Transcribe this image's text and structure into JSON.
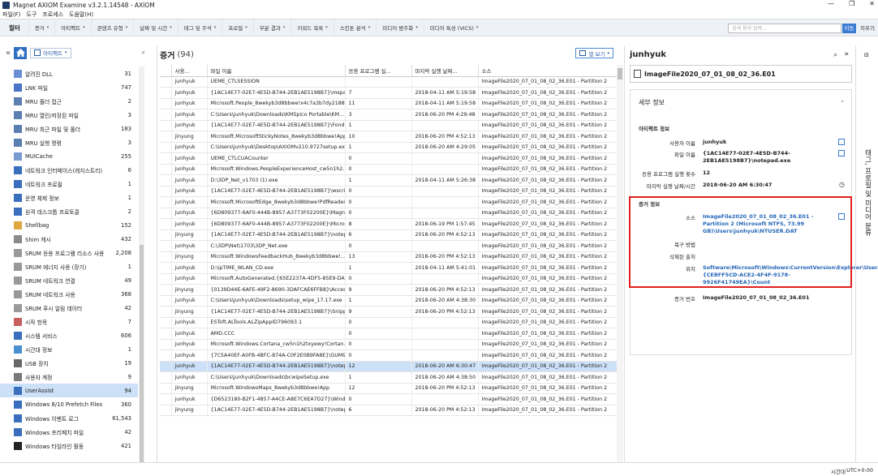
{
  "window": {
    "title": "Magnet AXIOM Examine v3.2.1.14548 - AXIOM",
    "minimize": "—",
    "maximize": "❐",
    "close": "✕"
  },
  "menu": [
    "파일(F)",
    "도구",
    "프로세스",
    "도움말(H)"
  ],
  "filterbar": {
    "label": "필터",
    "items": [
      "증거",
      "아티팩트",
      "콘텐츠 유형",
      "날짜 및 시간",
      "태그 및 주석",
      "프로필",
      "부분 결과",
      "키워드 목록",
      "스킨톤 분석",
      "미디어 범주화",
      "미디어 특성 (VICS)"
    ],
    "search_placeholder": "검색 용어 입력...",
    "go": "이동",
    "reset": "지우기"
  },
  "left": {
    "artifact_button": "아티팩트",
    "items": [
      {
        "label": "알려진 DLL",
        "count": "31",
        "color": "#6a8fd6"
      },
      {
        "label": "LNK 파일",
        "count": "747",
        "color": "#4a74c8"
      },
      {
        "label": "MRU 폴더 접근",
        "count": "2",
        "color": "#5b7fb0"
      },
      {
        "label": "MRU 열린/저장된 파일",
        "count": "3",
        "color": "#5b7fb0"
      },
      {
        "label": "MRU 최근 파일 및 폴더",
        "count": "183",
        "color": "#5b7fb0"
      },
      {
        "label": "MRU 실행 명령",
        "count": "3",
        "color": "#5b7fb0"
      },
      {
        "label": "MUICache",
        "count": "255",
        "color": "#7a9bcf"
      },
      {
        "label": "네트워크 인터페이스(레지스트리)",
        "count": "6",
        "color": "#3a6fbe"
      },
      {
        "label": "네트워크 프로필",
        "count": "1",
        "color": "#3a6fbe"
      },
      {
        "label": "운영 체제 정보",
        "count": "1",
        "color": "#3a6fbe"
      },
      {
        "label": "원격 데스크톱 프로토콜",
        "count": "2",
        "color": "#3a6fbe"
      },
      {
        "label": "Shellbag",
        "count": "152",
        "color": "#e0a640"
      },
      {
        "label": "Shim 캐시",
        "count": "432",
        "color": "#8a8a8a"
      },
      {
        "label": "SRUM 응용 프로그램 리소스 사용",
        "count": "2,208",
        "color": "#999"
      },
      {
        "label": "SRUM 에너지 사용 (장기)",
        "count": "1",
        "color": "#999"
      },
      {
        "label": "SRUM 네트워크 연결",
        "count": "49",
        "color": "#999"
      },
      {
        "label": "SRUM 네트워크 사용",
        "count": "368",
        "color": "#999"
      },
      {
        "label": "SRUM 푸시 알림 데이터",
        "count": "42",
        "color": "#999"
      },
      {
        "label": "시작 항목",
        "count": "7",
        "color": "#c86060"
      },
      {
        "label": "시스템 서비스",
        "count": "606",
        "color": "#3a6fbe"
      },
      {
        "label": "시간대 정보",
        "count": "1",
        "color": "#4a90d0"
      },
      {
        "label": "USB 장치",
        "count": "19",
        "color": "#666"
      },
      {
        "label": "사용자 계정",
        "count": "9",
        "color": "#7a7a7a"
      },
      {
        "label": "UserAssist",
        "count": "94",
        "color": "#3a6fbe"
      },
      {
        "label": "Windows 8/10 Prefetch Files",
        "count": "360",
        "color": "#3a6fbe"
      },
      {
        "label": "Windows 이벤트 로그",
        "count": "61,543",
        "color": "#3a6fbe"
      },
      {
        "label": "Windows 프리페치 파일",
        "count": "42",
        "color": "#3a6fbe"
      },
      {
        "label": "Windows 타임라인 활동",
        "count": "421",
        "color": "#222"
      }
    ],
    "selected_index": 23
  },
  "middle": {
    "title": "증거",
    "count": "(94)",
    "view_button": "열 보기",
    "columns": [
      "",
      "사용...",
      "파일 이름",
      "응용 프로그램 실...",
      "마지막 실행 날짜...",
      "소스"
    ],
    "rows": [
      [
        "junhyuk",
        "UEME_CTLSESSION",
        "",
        "",
        "ImageFile2020_07_01_08_02_36.E01 - Partition 2"
      ],
      [
        "junhyuk",
        "{1AC14E77-02E7-4E5D-B744-2EB1AE5198B7}\\mspai...",
        "7",
        "2018-04-11 AM 5:19:58",
        "ImageFile2020_07_01_08_02_36.E01 - Partition 2"
      ],
      [
        "junhyuk",
        "Microsoft.People_8wekyb3d8bbwe!x4c7a3b7dy2188...",
        "11",
        "2018-04-11 AM 5:19:58",
        "ImageFile2020_07_01_08_02_36.E01 - Partition 2"
      ],
      [
        "junhyuk",
        "C:\\Users\\junhyuk\\Downloads\\KMSpico Portable\\KM...",
        "3",
        "2018-06-20 PM 4:29:48",
        "ImageFile2020_07_01_08_02_36.E01 - Partition 2"
      ],
      [
        "junhyuk",
        "{1AC14E77-02E7-4E5D-B744-2EB1AE5198B7}\\Fondu...",
        "1",
        "",
        "ImageFile2020_07_01_08_02_36.E01 - Partition 2"
      ],
      [
        "jinyung",
        "Microsoft.MicrosoftStickyNotes_8wekyb3d8bbwe!App",
        "10",
        "2018-06-20 PM 4:52:13",
        "ImageFile2020_07_01_08_02_36.E01 - Partition 2"
      ],
      [
        "junhyuk",
        "C:\\Users\\junhyuk\\Desktop\\AXIOMv210.9727setup.exe",
        "1",
        "2018-06-20 AM 4:29:05",
        "ImageFile2020_07_01_08_02_36.E01 - Partition 2"
      ],
      [
        "junhyuk",
        "UEME_CTLCUACounter",
        "0",
        "",
        "ImageFile2020_07_01_08_02_36.E01 - Partition 2"
      ],
      [
        "junhyuk",
        "Microsoft.Windows.PeopleExperienceHost_cw5n1h2...",
        "0",
        "",
        "ImageFile2020_07_01_08_02_36.E01 - Partition 2"
      ],
      [
        "junhyuk",
        "D:\\3DP_Net_v1703 (1).exe",
        "1",
        "2018-04-11 AM 5:26:38",
        "ImageFile2020_07_01_08_02_36.E01 - Partition 2"
      ],
      [
        "junhyuk",
        "{1AC14E77-02E7-4E5D-B744-2EB1AE5198B7}\\wscrip...",
        "0",
        "",
        "ImageFile2020_07_01_08_02_36.E01 - Partition 2"
      ],
      [
        "junhyuk",
        "Microsoft.MicrosoftEdge_8wekyb3d8bbwe!PdfReader",
        "0",
        "",
        "ImageFile2020_07_01_08_02_36.E01 - Partition 2"
      ],
      [
        "junhyuk",
        "{6D809377-6AF0-444B-8957-A3773F02200E}\\Magn...",
        "0",
        "",
        "ImageFile2020_07_01_08_02_36.E01 - Partition 2"
      ],
      [
        "junhyuk",
        "{6D809377-6AF0-444B-8957-A3773F02200E}\\Micros...",
        "8",
        "2018-06-19 PM 1:57:45",
        "ImageFile2020_07_01_08_02_36.E01 - Partition 2"
      ],
      [
        "jinyung",
        "{1AC14E77-02E7-4E5D-B744-2EB1AE5198B7}\\notep...",
        "6",
        "2018-06-20 PM 4:52:13",
        "ImageFile2020_07_01_08_02_36.E01 - Partition 2"
      ],
      [
        "junhyuk",
        "C:\\3DP\\Net\\1703\\3DP_Net.exe",
        "0",
        "",
        "ImageFile2020_07_01_08_02_36.E01 - Partition 2"
      ],
      [
        "jinyung",
        "Microsoft.WindowsFeedbackHub_8wekyb3d8bbwe!...",
        "13",
        "2018-06-20 PM 4:52:13",
        "ImageFile2020_07_01_08_02_36.E01 - Partition 2"
      ],
      [
        "junhyuk",
        "D:\\ipTIME_WLAN_CD.exe",
        "1",
        "2018-04-11 AM 5:41:01",
        "ImageFile2020_07_01_08_02_36.E01 - Partition 2"
      ],
      [
        "junhyuk",
        "Microsoft.AutoGenerated.{65E2237A-4DF5-85E9-DA...",
        "0",
        "",
        "ImageFile2020_07_01_08_02_36.E01 - Partition 2"
      ],
      [
        "jinyung",
        "{0139D44E-6AFE-49F2-8690-3DAFCAE6FFB8}\\Acces...",
        "9",
        "2018-06-20 PM 4:52:13",
        "ImageFile2020_07_01_08_02_36.E01 - Partition 2"
      ],
      [
        "junhyuk",
        "C:\\Users\\junhyuk\\Downloads\\setup_wipe_17.17.exe",
        "1",
        "2018-06-20 AM 4:38:30",
        "ImageFile2020_07_01_08_02_36.E01 - Partition 2"
      ],
      [
        "jinyung",
        "{1AC14E77-02E7-4E5D-B744-2EB1AE5198B7}\\Snippi...",
        "9",
        "2018-06-20 PM 4:52:13",
        "ImageFile2020_07_01_08_02_36.E01 - Partition 2"
      ],
      [
        "junhyuk",
        "ESToft.ALTools.ALZipAppID796093.1",
        "0",
        "",
        "ImageFile2020_07_01_08_02_36.E01 - Partition 2"
      ],
      [
        "junhyuk",
        "AMD.CCC",
        "0",
        "",
        "ImageFile2020_07_01_08_02_36.E01 - Partition 2"
      ],
      [
        "junhyuk",
        "Microsoft.Windows.Cortana_cw5n1h2txyewy!Cortan...",
        "0",
        "",
        "ImageFile2020_07_01_08_02_36.E01 - Partition 2"
      ],
      [
        "junhyuk",
        "{7C5A40EF-A0FB-4BFC-874A-C0F2E0B9FA8E}\\GUM9...",
        "0",
        "",
        "ImageFile2020_07_01_08_02_36.E01 - Partition 2"
      ],
      [
        "junhyuk",
        "{1AC14E77-02E7-4E5D-B744-2EB1AE5198B7}\\notep...",
        "12",
        "2018-06-20 AM 6:30:47",
        "ImageFile2020_07_01_08_02_36.E01 - Partition 2"
      ],
      [
        "junhyuk",
        "C:\\Users\\junhyuk\\Downloads\\bcwipeSetup.exe",
        "1",
        "2018-06-20 AM 4:38:50",
        "ImageFile2020_07_01_08_02_36.E01 - Partition 2"
      ],
      [
        "jinyung",
        "Microsoft.WindowsMaps_8wekyb3d8bbwe!App",
        "12",
        "2018-06-20 PM 4:52:13",
        "ImageFile2020_07_01_08_02_36.E01 - Partition 2"
      ],
      [
        "junhyuk",
        "{D6523180-B2F1-4857-A4CE-A8E7C6EA7D27}\\Wind...",
        "0",
        "",
        "ImageFile2020_07_01_08_02_36.E01 - Partition 2"
      ],
      [
        "jinyung",
        "{1AC14E77-02E7-4E5D-B744-2EB1AE5198B7}\\notep...",
        "6",
        "2018-06-20 PM 4:52:13",
        "ImageFile2020_07_01_08_02_36.E01 - Partition 2"
      ]
    ],
    "selected_row": 26
  },
  "right": {
    "user": "junhyuk",
    "file": "ImageFile2020_07_01_08_02_36.E01",
    "details_title": "세부 정보",
    "artifact_info": "아티팩트 정보",
    "user_label": "사용자 이름",
    "user_value": "junhyuk",
    "filename_label": "파일 이름",
    "filename_value": "{1AC14E77-02E7-4E5D-B744-2EB1AE5198B7}\\notepad.exe",
    "runcount_label": "응용 프로그램 실행 횟수",
    "runcount_value": "12",
    "lastrun_label": "마지막 실행 날짜/시간",
    "lastrun_value": "2018-06-20 AM 6:30:47",
    "evidence_info": "증거 정보",
    "source_label": "소스",
    "source_value": "ImageFile2020_07_01_08_02_36.E01 - Partition 2 (Microsoft NTFS, 73.99 GB)\\Users\\junhyuk\\NTUSER.DAT",
    "recovery_label": "복구 방법",
    "deleted_label": "삭제된 출처",
    "location_label": "위치",
    "location_value": "Software\\Microsoft\\Windows\\CurrentVersion\\Explorer\\UserAssist\\{CEBFF5CD-ACE2-4F4F-9178-9926F41749EA}\\Count",
    "evidence_num_label": "증거 번호",
    "evidence_num_value": "ImageFile2020_07_01_08_02_36.E01"
  },
  "vtab": "태그, 프로필 및 미디어 분류",
  "status": {
    "tz_label": "시간대",
    "tz_value": "UTC+0:00"
  }
}
